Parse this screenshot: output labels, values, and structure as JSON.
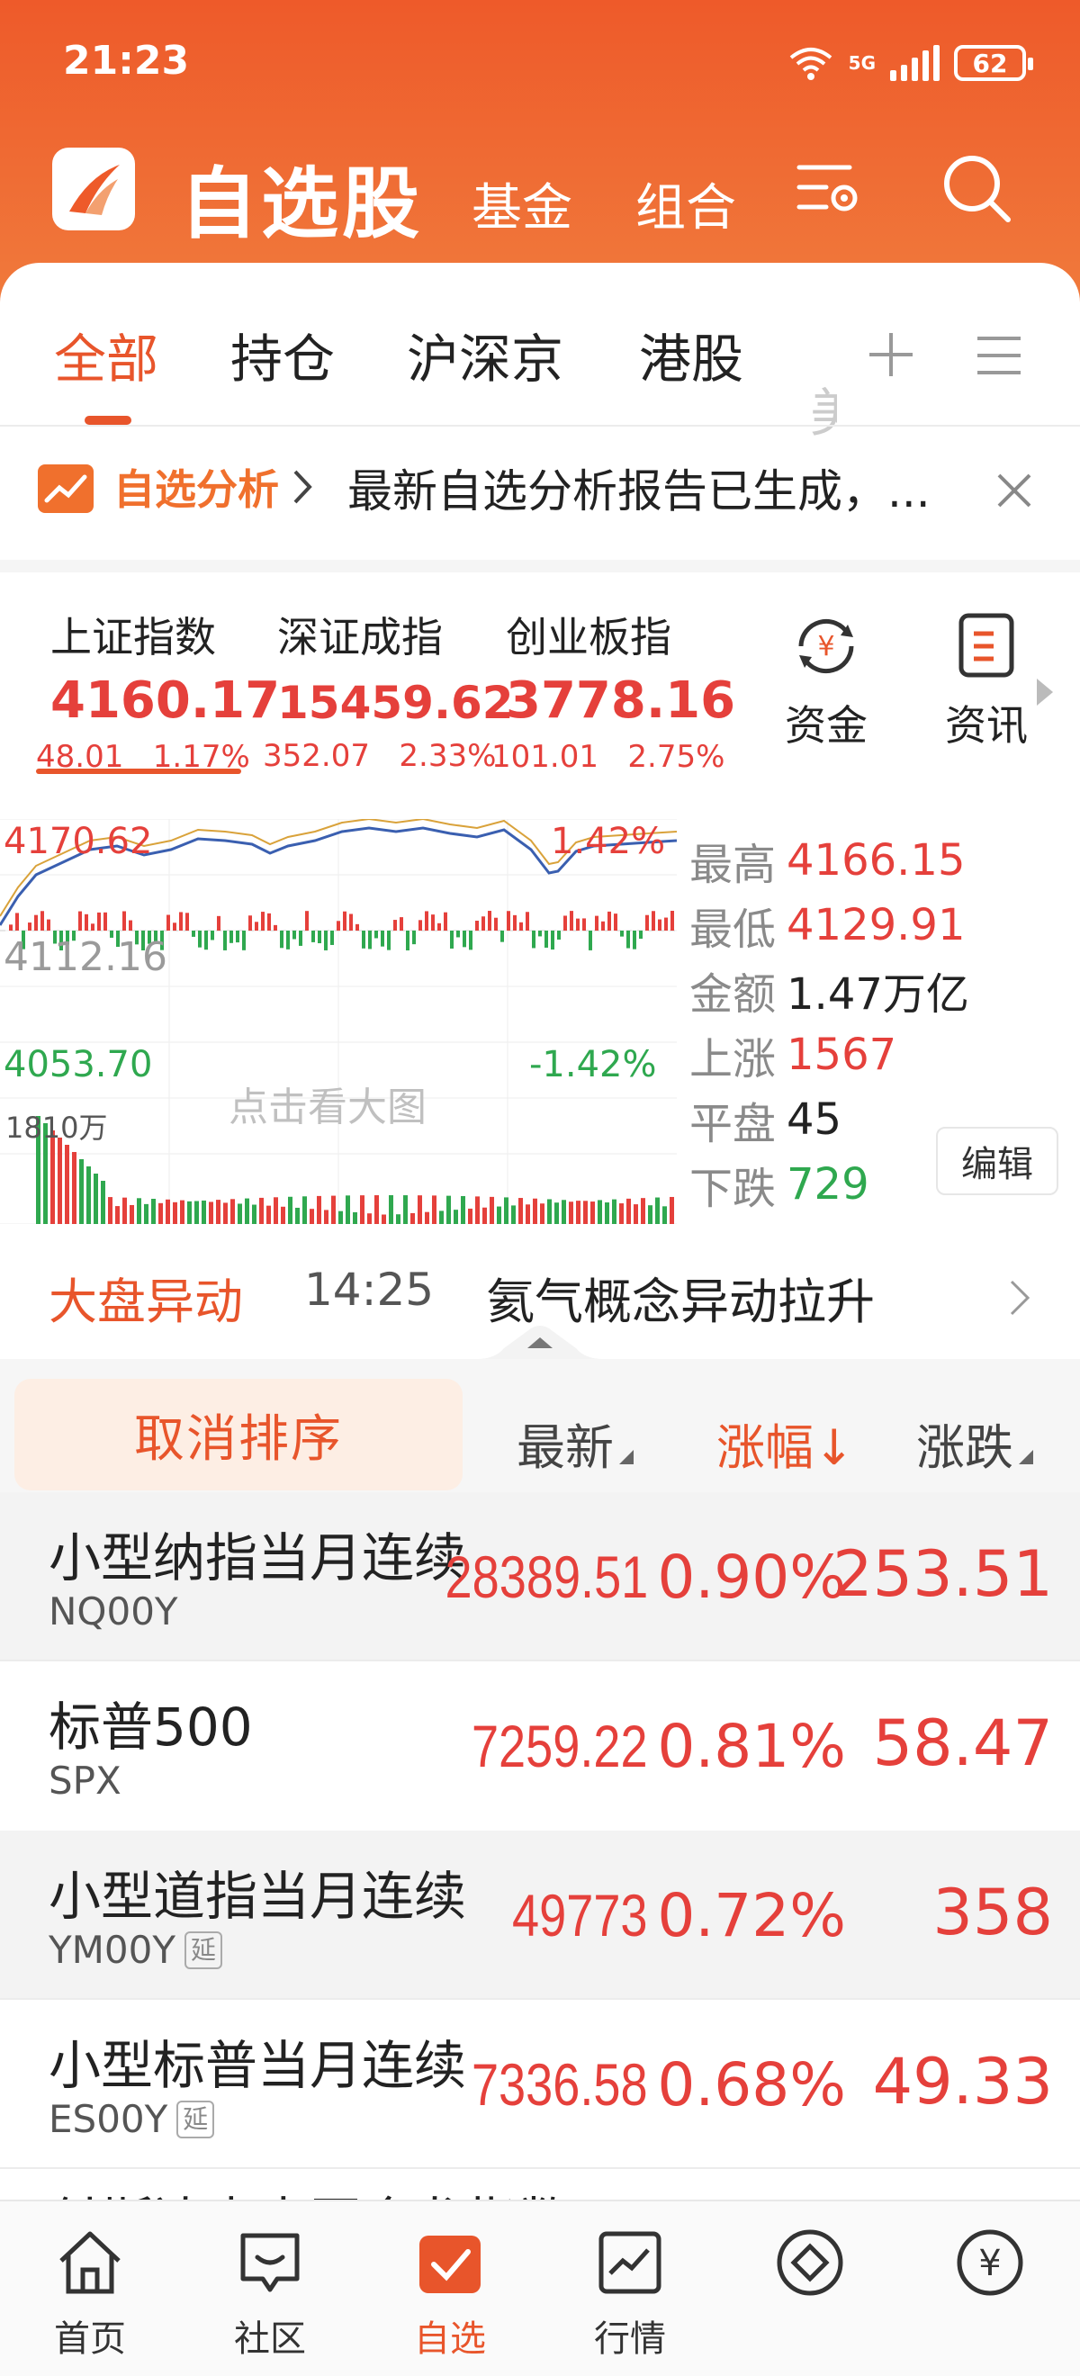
{
  "status_bar": {
    "time": "21:23",
    "network": "5G",
    "battery": "62"
  },
  "app_bar": {
    "title": "自选股",
    "tab_fund": "基金",
    "tab_combo": "组合"
  },
  "tabs": {
    "all": "全部",
    "holding": "持仓",
    "sh_sz_bj": "沪深京",
    "hk": "港股",
    "partial": "美"
  },
  "analysis": {
    "label": "自选分析",
    "text": "最新自选分析报告已生成，..."
  },
  "indices": [
    {
      "name": "上证指数",
      "value": "4160.17",
      "change": "48.01",
      "pct": "1.17%"
    },
    {
      "name": "深证成指",
      "value": "15459.62",
      "change": "352.07",
      "pct": "2.33%"
    },
    {
      "name": "创业板指",
      "value": "3778.16",
      "change": "101.01",
      "pct": "2.75%"
    }
  ],
  "quick_actions": {
    "funds": "资金",
    "news": "资讯"
  },
  "chart": {
    "high_label": "4170.62",
    "high_pct": "1.42%",
    "mid_label": "4112.16",
    "low_label": "4053.70",
    "low_pct": "-1.42%",
    "volume_label": "1810万",
    "overlay": "点击看大图"
  },
  "stats": {
    "high_label": "最高",
    "high": "4166.15",
    "low_label": "最低",
    "low": "4129.91",
    "amount_label": "金额",
    "amount": "1.47万亿",
    "up_label": "上涨",
    "up": "1567",
    "flat_label": "平盘",
    "flat": "45",
    "down_label": "下跌",
    "down": "729",
    "edit": "编辑"
  },
  "movement": {
    "title": "大盘异动",
    "time": "14:25",
    "text": "氦气概念异动拉升"
  },
  "list_header": {
    "cancel_sort": "取消排序",
    "latest": "最新",
    "pct": "涨幅↓",
    "change": "涨跌"
  },
  "stocks": [
    {
      "name": "小型纳指当月连续",
      "code": "NQ00Y",
      "price": "28389.51",
      "pct": "0.90%",
      "change": "253.51",
      "delayed": false
    },
    {
      "name": "标普500",
      "code": "SPX",
      "price": "7259.22",
      "pct": "0.81%",
      "change": "58.47",
      "delayed": false
    },
    {
      "name": "小型道指当月连续",
      "code": "YM00Y",
      "price": "49773",
      "pct": "0.72%",
      "change": "358",
      "delayed": true,
      "delay_badge": "延"
    },
    {
      "name": "小型标普当月连续",
      "code": "ES00Y",
      "price": "7336.58",
      "pct": "0.68%",
      "change": "49.33",
      "delayed": true,
      "delay_badge": "延"
    }
  ],
  "partial_row": "付斯达克中国金龙指数",
  "bottom_nav": {
    "home": "首页",
    "community": "社区",
    "watchlist": "自选",
    "market": "行情",
    "trade": "",
    "finance": ""
  },
  "colors": {
    "brand": "#e8552b",
    "up": "#e5403b",
    "down": "#2fa84f"
  }
}
